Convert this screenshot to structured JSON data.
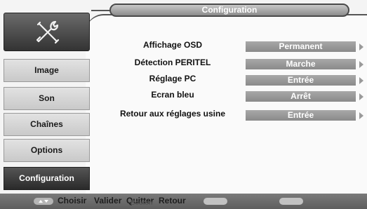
{
  "header": {
    "title": "Configuration"
  },
  "sidebar": {
    "icon": "tools-icon",
    "items": [
      {
        "label": "Image",
        "active": false
      },
      {
        "label": "Son",
        "active": false
      },
      {
        "label": "Chaînes",
        "active": false
      },
      {
        "label": "Options",
        "active": false
      },
      {
        "label": "Configuration",
        "active": true
      }
    ]
  },
  "settings": [
    {
      "label": "Affichage OSD",
      "value": "Permanent"
    },
    {
      "label": "Détection PERITEL",
      "value": "Marche"
    },
    {
      "label": "Réglage PC",
      "value": "Entrée"
    },
    {
      "label": "Ecran bleu",
      "value": "Arrêt"
    },
    {
      "label": "Retour aux réglages usine",
      "value": "Entrée"
    }
  ],
  "footer": {
    "choose": "Choisir",
    "validate": "Valider",
    "quit": "Quitter",
    "back": "Retour",
    "overlay": "Bouton"
  },
  "colors": {
    "active_tab": "#333333",
    "value_box": "#999999",
    "bottom_bar": "#6a6a6a"
  }
}
